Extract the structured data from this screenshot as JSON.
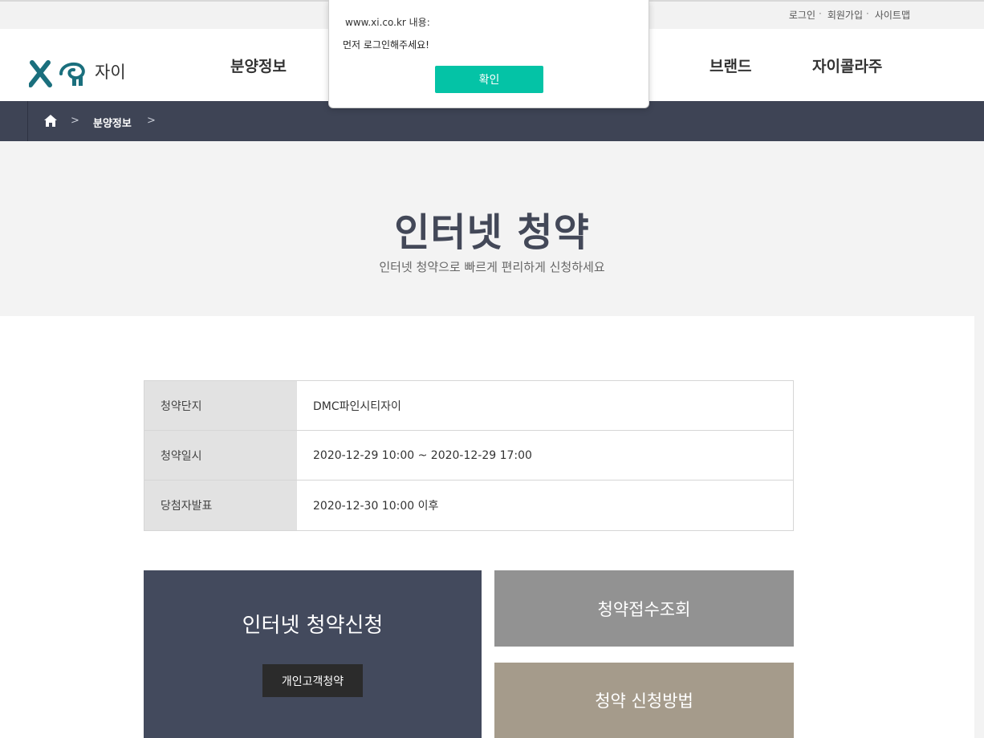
{
  "top_links": [
    "로그인",
    "회원가입",
    "사이트맵"
  ],
  "logo": {
    "text": "자이"
  },
  "nav": {
    "item_1": "분양정보",
    "item_2": "브랜드",
    "item_3": "자이콜라주"
  },
  "breadcrumb": {
    "current": "분양정보"
  },
  "hero": {
    "title": "인터넷 청약",
    "subtitle": "인터넷 청약으로 빠르게 편리하게 신청하세요"
  },
  "info_table": [
    {
      "label": "청약단지",
      "value": "DMC파인시티자이"
    },
    {
      "label": "청약일시",
      "value": "2020-12-29 10:00 ~ 2020-12-29 17:00"
    },
    {
      "label": "당첨자발표",
      "value": "2020-12-30 10:00 이후"
    }
  ],
  "tiles": {
    "apply_title": "인터넷 청약신청",
    "apply_button": "개인고객청약",
    "lookup": "청약접수조회",
    "howto": "청약 신청방법"
  },
  "dialog": {
    "origin": "www.xi.co.kr 내용:",
    "message": "먼저 로그인해주세요!",
    "ok_label": "확인"
  },
  "colors": {
    "breadcrumb_bg": "#3e4455",
    "hero_bg": "#f3f3f3",
    "apply_tile": "#434a5d",
    "lookup_tile": "#929292",
    "howto_tile": "#a59b8b",
    "dialog_button": "#04c3a6",
    "logo_teal": "#1a6f7d"
  },
  "icons": [
    "home-icon",
    "chevron-right-icon",
    "xi-logo"
  ]
}
